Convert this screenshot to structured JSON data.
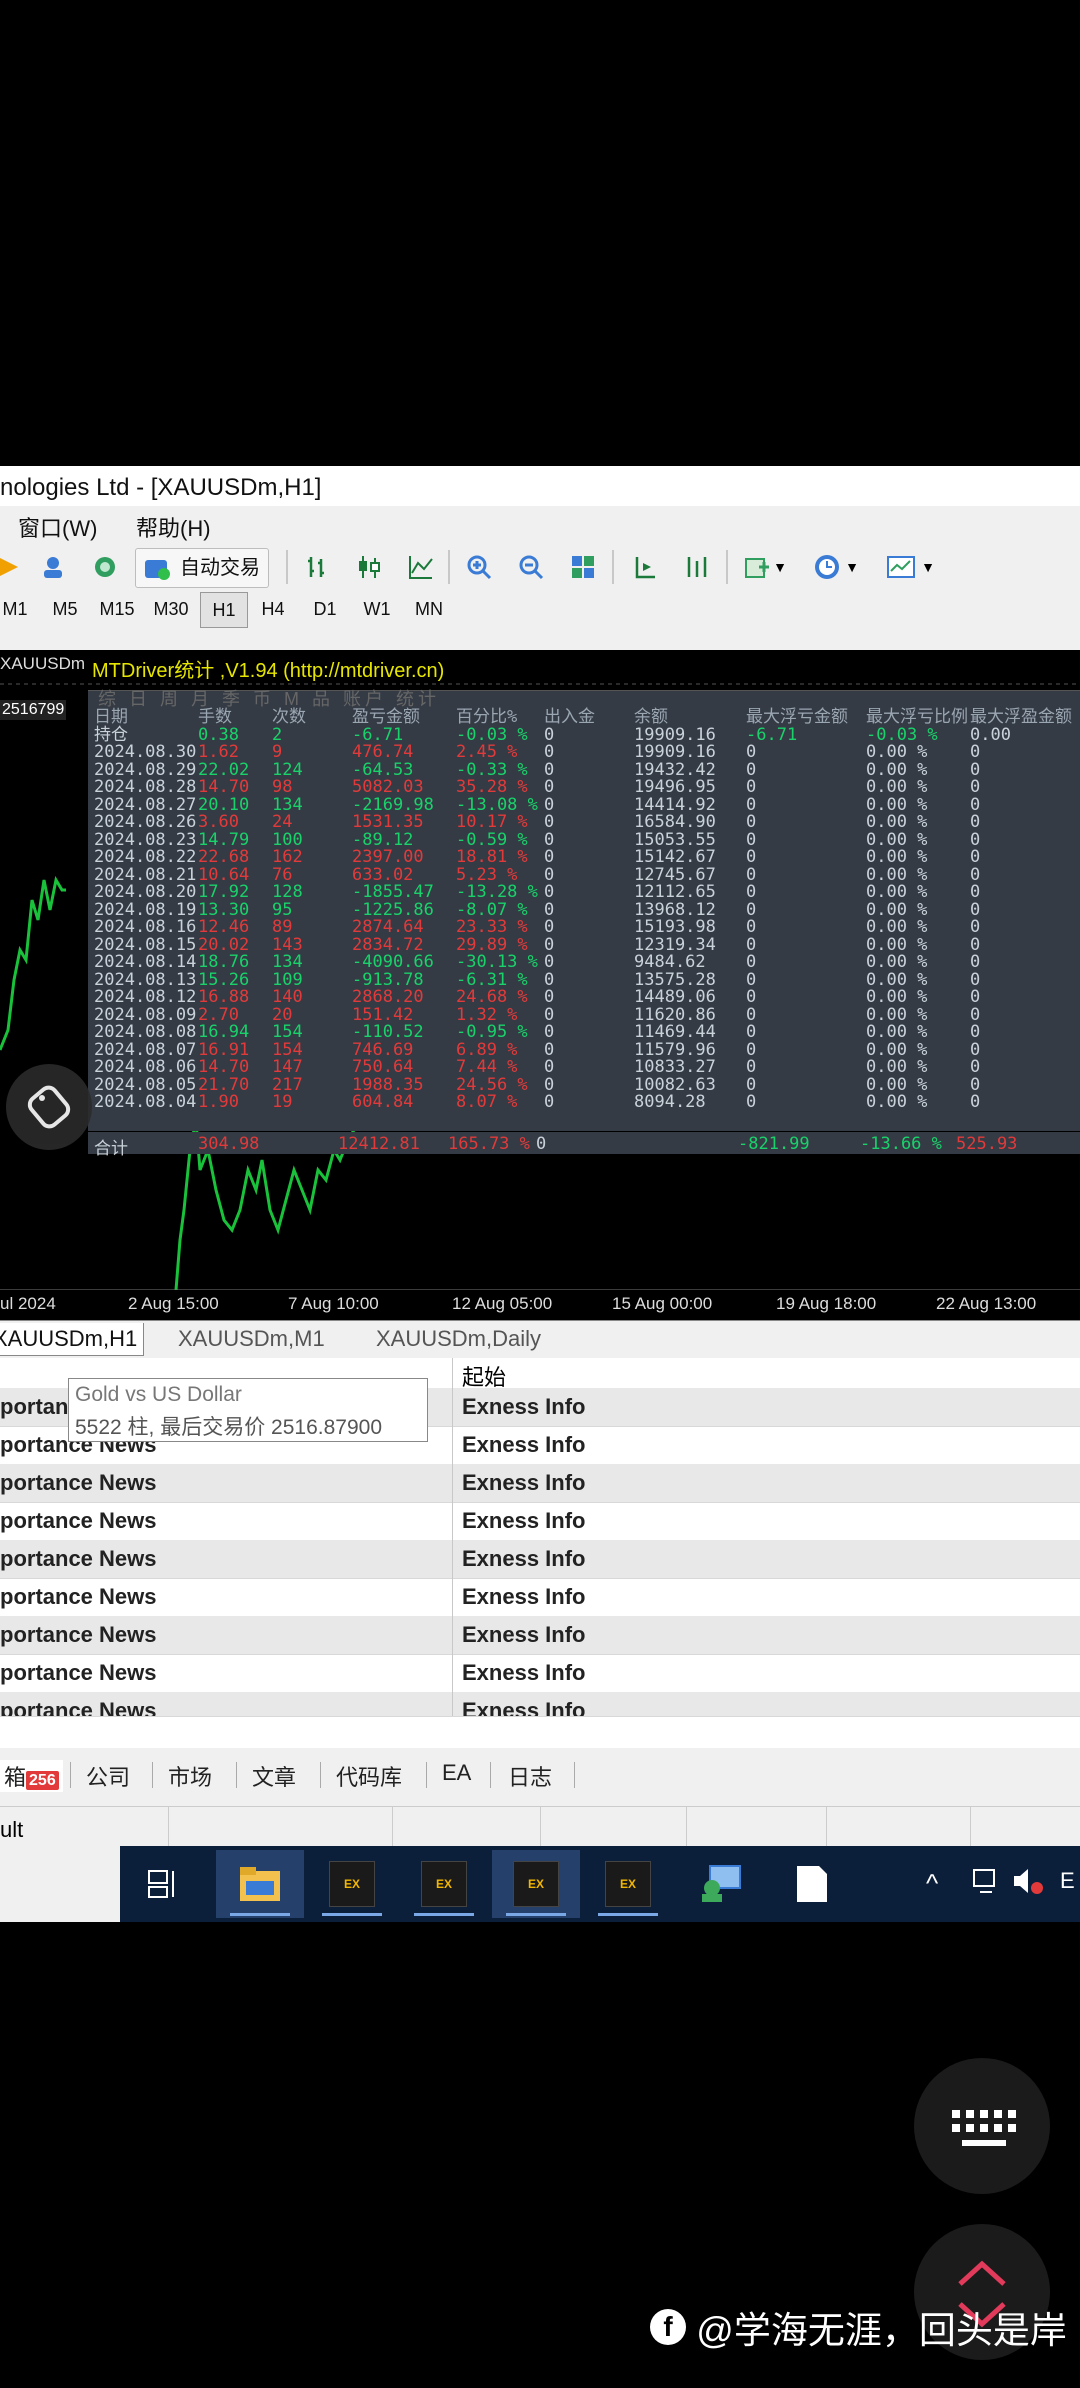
{
  "window": {
    "title": "nologies Ltd - [XAUUSDm,H1]"
  },
  "menu": {
    "window": "窗口(W)",
    "help": "帮助(H)"
  },
  "toolbar": {
    "auto_trading": "自动交易"
  },
  "timeframes": [
    "M1",
    "M5",
    "M15",
    "M30",
    "H1",
    "H4",
    "D1",
    "W1",
    "MN"
  ],
  "timeframe_active": "H1",
  "chart": {
    "symbol_label": "XAUUSDm",
    "price_label": "2516799",
    "x_labels": [
      "ul 2024",
      "2 Aug 15:00",
      "7 Aug 10:00",
      "12 Aug 05:00",
      "15 Aug 00:00",
      "19 Aug 18:00",
      "22 Aug 13:00"
    ]
  },
  "indicator": {
    "title": "MTDriver统计 ,V1.94 (http://mtdriver.cn)",
    "filter_tabs": "综 日 周 月 季 币 M 品 账户 统计",
    "headers": [
      "日期",
      "手数",
      "次数",
      "盈亏金额",
      "百分比%",
      "出入金",
      "余额",
      "最大浮亏金额",
      "最大浮亏比例",
      "最大浮盈金额"
    ],
    "rows": [
      [
        "持仓",
        "0.38",
        "2",
        "-6.71",
        "-0.03 %",
        "0",
        "19909.16",
        "-6.71",
        "-0.03 %",
        "0.00",
        "g"
      ],
      [
        "2024.08.30",
        "1.62",
        "9",
        "476.74",
        "2.45 %",
        "0",
        "19909.16",
        "0",
        "0.00 %",
        "0",
        "r"
      ],
      [
        "2024.08.29",
        "22.02",
        "124",
        "-64.53",
        "-0.33 %",
        "0",
        "19432.42",
        "0",
        "0.00 %",
        "0",
        "g"
      ],
      [
        "2024.08.28",
        "14.70",
        "98",
        "5082.03",
        "35.28 %",
        "0",
        "19496.95",
        "0",
        "0.00 %",
        "0",
        "r"
      ],
      [
        "2024.08.27",
        "20.10",
        "134",
        "-2169.98",
        "-13.08 %",
        "0",
        "14414.92",
        "0",
        "0.00 %",
        "0",
        "g"
      ],
      [
        "2024.08.26",
        "3.60",
        "24",
        "1531.35",
        "10.17 %",
        "0",
        "16584.90",
        "0",
        "0.00 %",
        "0",
        "r"
      ],
      [
        "2024.08.23",
        "14.79",
        "100",
        "-89.12",
        "-0.59 %",
        "0",
        "15053.55",
        "0",
        "0.00 %",
        "0",
        "g"
      ],
      [
        "2024.08.22",
        "22.68",
        "162",
        "2397.00",
        "18.81 %",
        "0",
        "15142.67",
        "0",
        "0.00 %",
        "0",
        "r"
      ],
      [
        "2024.08.21",
        "10.64",
        "76",
        "633.02",
        "5.23 %",
        "0",
        "12745.67",
        "0",
        "0.00 %",
        "0",
        "r"
      ],
      [
        "2024.08.20",
        "17.92",
        "128",
        "-1855.47",
        "-13.28 %",
        "0",
        "12112.65",
        "0",
        "0.00 %",
        "0",
        "g"
      ],
      [
        "2024.08.19",
        "13.30",
        "95",
        "-1225.86",
        "-8.07 %",
        "0",
        "13968.12",
        "0",
        "0.00 %",
        "0",
        "g"
      ],
      [
        "2024.08.16",
        "12.46",
        "89",
        "2874.64",
        "23.33 %",
        "0",
        "15193.98",
        "0",
        "0.00 %",
        "0",
        "r"
      ],
      [
        "2024.08.15",
        "20.02",
        "143",
        "2834.72",
        "29.89 %",
        "0",
        "12319.34",
        "0",
        "0.00 %",
        "0",
        "r"
      ],
      [
        "2024.08.14",
        "18.76",
        "134",
        "-4090.66",
        "-30.13 %",
        "0",
        "9484.62",
        "0",
        "0.00 %",
        "0",
        "g"
      ],
      [
        "2024.08.13",
        "15.26",
        "109",
        "-913.78",
        "-6.31 %",
        "0",
        "13575.28",
        "0",
        "0.00 %",
        "0",
        "g"
      ],
      [
        "2024.08.12",
        "16.88",
        "140",
        "2868.20",
        "24.68 %",
        "0",
        "14489.06",
        "0",
        "0.00 %",
        "0",
        "r"
      ],
      [
        "2024.08.09",
        "2.70",
        "20",
        "151.42",
        "1.32 %",
        "0",
        "11620.86",
        "0",
        "0.00 %",
        "0",
        "r"
      ],
      [
        "2024.08.08",
        "16.94",
        "154",
        "-110.52",
        "-0.95 %",
        "0",
        "11469.44",
        "0",
        "0.00 %",
        "0",
        "g"
      ],
      [
        "2024.08.07",
        "16.91",
        "154",
        "746.69",
        "6.89 %",
        "0",
        "11579.96",
        "0",
        "0.00 %",
        "0",
        "r"
      ],
      [
        "2024.08.06",
        "14.70",
        "147",
        "750.64",
        "7.44 %",
        "0",
        "10833.27",
        "0",
        "0.00 %",
        "0",
        "r"
      ],
      [
        "2024.08.05",
        "21.70",
        "217",
        "1988.35",
        "24.56 %",
        "0",
        "10082.63",
        "0",
        "0.00 %",
        "0",
        "r"
      ],
      [
        "2024.08.04",
        "1.90",
        "19",
        "604.84",
        "8.07 %",
        "0",
        "8094.28",
        "0",
        "0.00 %",
        "0",
        "r"
      ]
    ],
    "total": {
      "label": "合计",
      "lots": "304.98",
      "pnl": "12412.81",
      "pct": "165.73 %",
      "cash": "0",
      "max_float_loss": "-821.99",
      "max_float_pct": "-13.66 %",
      "max_float_profit": "525.93"
    }
  },
  "chart_tabs": [
    "XAUUSDm,H1",
    "XAUUSDm,M1",
    "XAUUSDm,Daily"
  ],
  "news": {
    "header_col2": "起始",
    "tooltip_line1": "Gold vs US Dollar",
    "tooltip_line2": "5522 柱, 最后交易价 2516.87900",
    "first_row_title": "portan",
    "row_title": "portance News",
    "row_source": "Exness Info"
  },
  "terminal_tabs": {
    "first": "箱",
    "badge": "256",
    "items": [
      "公司",
      "市场",
      "文章",
      "代码库",
      "EA",
      "日志"
    ]
  },
  "status": {
    "text": "ult"
  },
  "taskbar": {
    "lang": "E"
  },
  "watermark": "@学海无涯，回头是岸"
}
